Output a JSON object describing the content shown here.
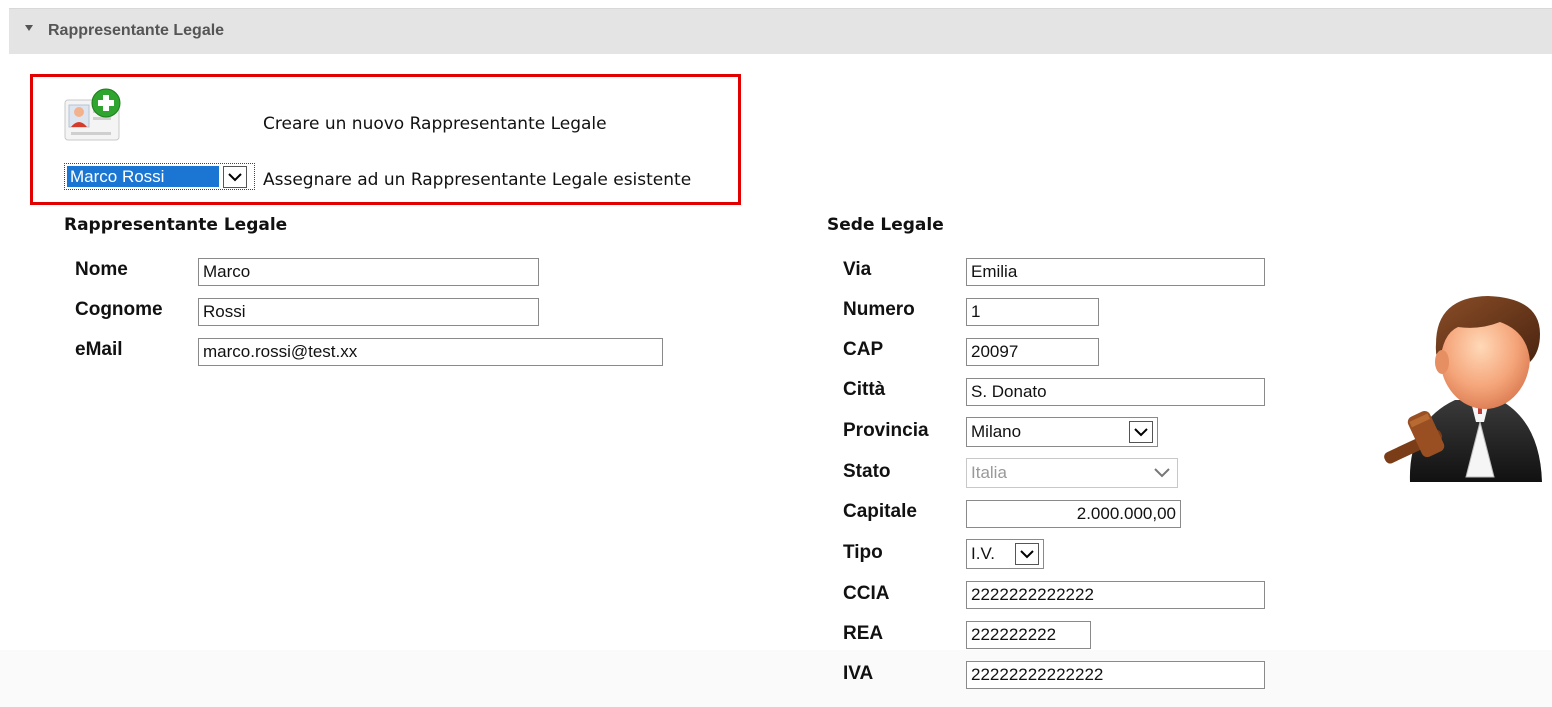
{
  "panel": {
    "title": "Rappresentante Legale"
  },
  "options": {
    "create_label": "Creare un nuovo Rappresentante Legale",
    "existing_selected": "Marco Rossi",
    "assign_label": "Assegnare ad un Rappresentante Legale esistente"
  },
  "rappresentante": {
    "title": "Rappresentante Legale",
    "fields": [
      {
        "label": "Nome",
        "value": "Marco"
      },
      {
        "label": "Cognome",
        "value": "Rossi"
      },
      {
        "label": "eMail",
        "value": "marco.rossi@test.xx"
      }
    ]
  },
  "sede": {
    "title": "Sede Legale",
    "fields": [
      {
        "label": "Via",
        "value": "Emilia"
      },
      {
        "label": "Numero",
        "value": "1"
      },
      {
        "label": "CAP",
        "value": "20097"
      },
      {
        "label": "Città",
        "value": "S. Donato"
      },
      {
        "label": "Provincia",
        "value": "Milano"
      },
      {
        "label": "Stato",
        "value": "Italia"
      },
      {
        "label": "Capitale",
        "value": "2.000.000,00"
      },
      {
        "label": "Tipo",
        "value": "I.V."
      },
      {
        "label": "CCIA",
        "value": "2222222222222"
      },
      {
        "label": "REA",
        "value": "222222222"
      },
      {
        "label": "IVA",
        "value": "22222222222222"
      }
    ]
  },
  "colors": {
    "highlight_box": "#e30000",
    "selected_option_bg": "#1a76d2"
  },
  "icons": [
    "expand-triangle-icon",
    "add-person-card-icon",
    "chevron-down-icon",
    "lawyer-avatar-icon"
  ]
}
